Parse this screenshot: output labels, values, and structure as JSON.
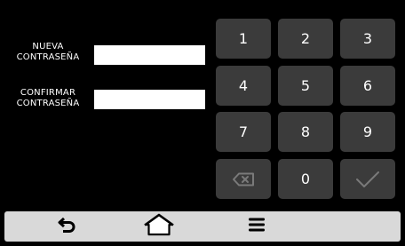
{
  "form": {
    "new_password": {
      "label_line1": "NUEVA",
      "label_line2": "CONTRASEÑA",
      "value": ""
    },
    "confirm_password": {
      "label_line1": "CONFIRMAR",
      "label_line2": "CONTRASEÑA",
      "value": ""
    }
  },
  "keypad": {
    "keys": [
      "1",
      "2",
      "3",
      "4",
      "5",
      "6",
      "7",
      "8",
      "9",
      "0"
    ],
    "backspace_icon": "backspace-icon",
    "confirm_icon": "checkmark-icon"
  },
  "bottom_bar": {
    "icons": [
      "back-arrow-icon",
      "home-icon",
      "menu-icon"
    ]
  },
  "colors": {
    "background": "#000000",
    "key_background": "#3b3b3b",
    "key_text": "#ffffff",
    "key_disabled_glyph": "#7a7a7a",
    "field_background": "#ffffff",
    "bottom_bar": "#d9d9d9"
  }
}
